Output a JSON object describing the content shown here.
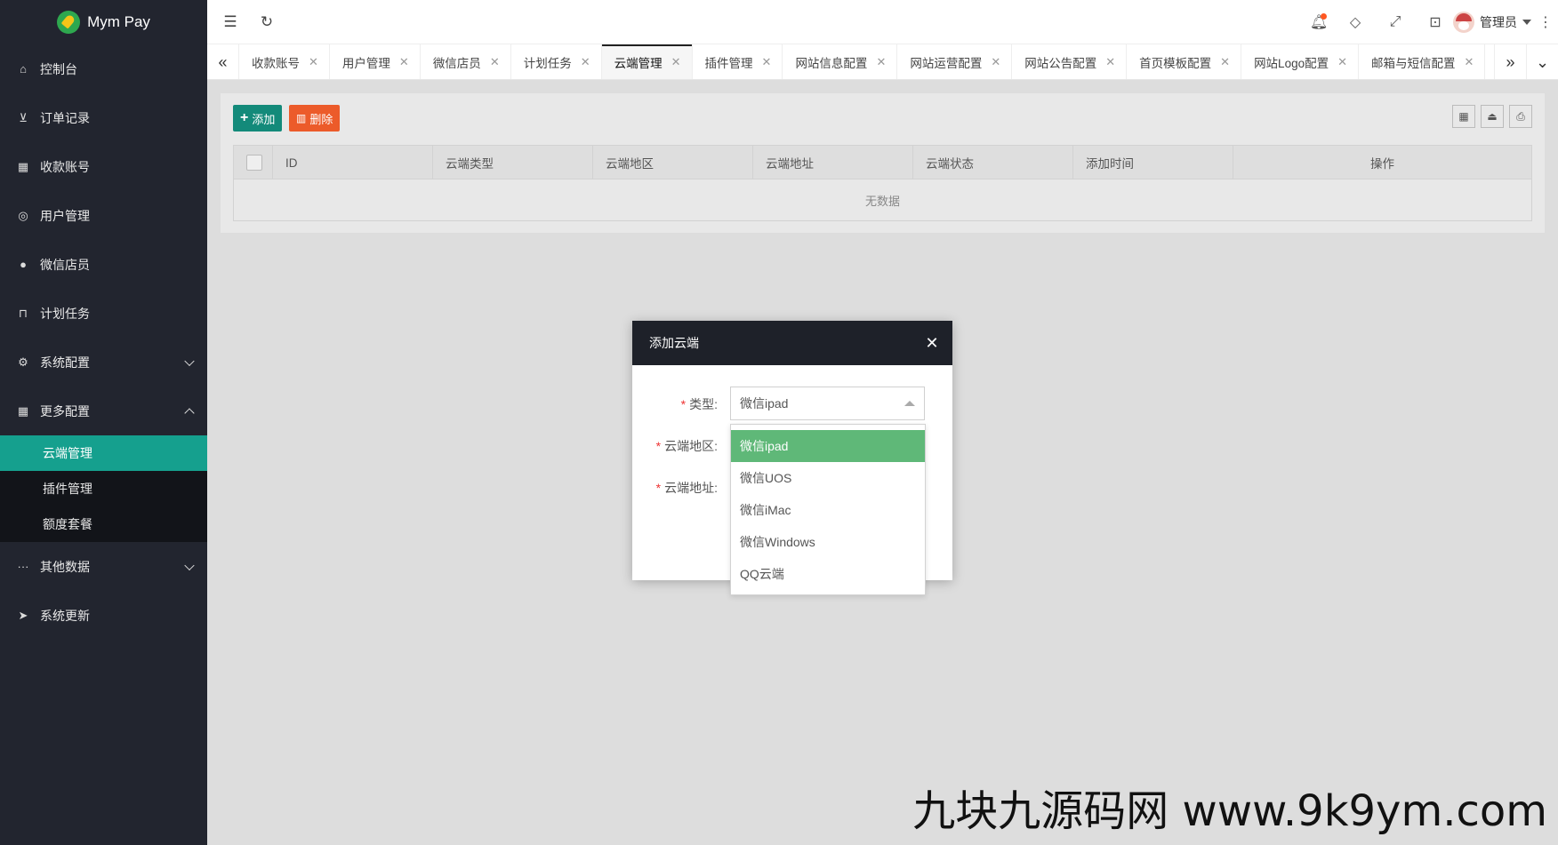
{
  "app": {
    "name": "Mym Pay"
  },
  "sidebar": {
    "items": [
      {
        "label": "控制台",
        "icon": "home-icon"
      },
      {
        "label": "订单记录",
        "icon": "cart-icon"
      },
      {
        "label": "收款账号",
        "icon": "apps-icon"
      },
      {
        "label": "用户管理",
        "icon": "user-icon"
      },
      {
        "label": "微信店员",
        "icon": "wechat-icon"
      },
      {
        "label": "计划任务",
        "icon": "tasks-icon"
      },
      {
        "label": "系统配置",
        "icon": "gear-icon",
        "expandable": true
      },
      {
        "label": "更多配置",
        "icon": "grid-icon",
        "expanded": true
      }
    ],
    "submenu": [
      {
        "label": "云端管理",
        "active": true
      },
      {
        "label": "插件管理"
      },
      {
        "label": "额度套餐"
      }
    ],
    "items_after": [
      {
        "label": "其他数据",
        "icon": "more-icon",
        "expandable": true
      },
      {
        "label": "系统更新",
        "icon": "send-icon"
      }
    ]
  },
  "header": {
    "user": "管理员"
  },
  "tabs": [
    {
      "label": "收款账号"
    },
    {
      "label": "用户管理"
    },
    {
      "label": "微信店员"
    },
    {
      "label": "计划任务"
    },
    {
      "label": "云端管理",
      "active": true
    },
    {
      "label": "插件管理"
    },
    {
      "label": "网站信息配置"
    },
    {
      "label": "网站运营配置"
    },
    {
      "label": "网站公告配置"
    },
    {
      "label": "首页模板配置"
    },
    {
      "label": "网站Logo配置"
    },
    {
      "label": "邮箱与短信配置"
    }
  ],
  "toolbar": {
    "add_label": "添加",
    "delete_label": "删除"
  },
  "table": {
    "columns": [
      "ID",
      "云端类型",
      "云端地区",
      "云端地址",
      "云端状态",
      "添加时间",
      "操作"
    ],
    "empty_text": "无数据"
  },
  "modal": {
    "title": "添加云端",
    "fields": [
      {
        "label": "类型:",
        "required": true,
        "value": "微信ipad"
      },
      {
        "label": "云端地区:",
        "required": true
      },
      {
        "label": "云端地址:",
        "required": true
      }
    ],
    "options": [
      "微信ipad",
      "微信UOS",
      "微信iMac",
      "微信Windows",
      "QQ云端"
    ],
    "selected_option": "微信ipad"
  },
  "colors": {
    "sidebar_bg": "#22252f",
    "active_teal": "#15a08e",
    "add_btn": "#138a7a",
    "delete_btn": "#ec5b2a",
    "option_selected": "#5fb878"
  },
  "watermark": "九块九源码网 www.9k9ym.com"
}
